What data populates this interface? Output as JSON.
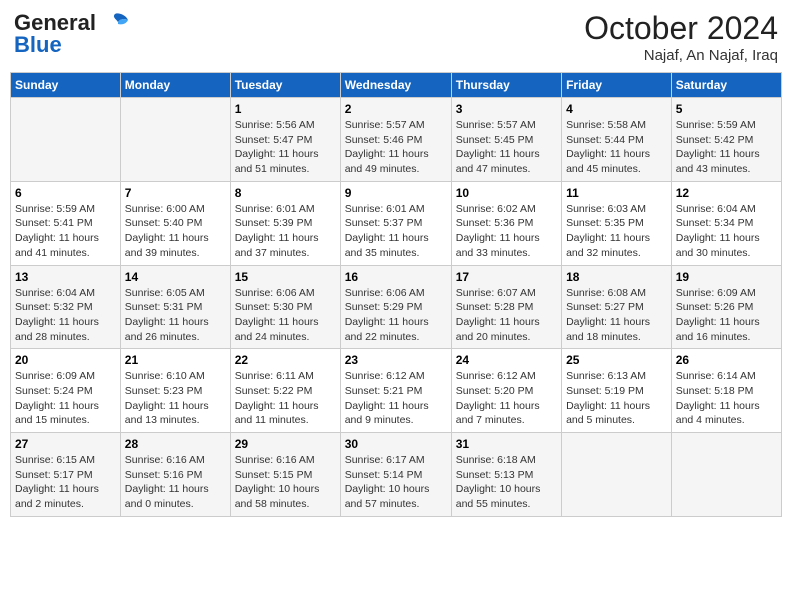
{
  "header": {
    "logo_general": "General",
    "logo_blue": "Blue",
    "month_title": "October 2024",
    "location": "Najaf, An Najaf, Iraq"
  },
  "weekdays": [
    "Sunday",
    "Monday",
    "Tuesday",
    "Wednesday",
    "Thursday",
    "Friday",
    "Saturday"
  ],
  "weeks": [
    [
      {
        "day": "",
        "sunrise": "",
        "sunset": "",
        "daylight": ""
      },
      {
        "day": "",
        "sunrise": "",
        "sunset": "",
        "daylight": ""
      },
      {
        "day": "1",
        "sunrise": "Sunrise: 5:56 AM",
        "sunset": "Sunset: 5:47 PM",
        "daylight": "Daylight: 11 hours and 51 minutes."
      },
      {
        "day": "2",
        "sunrise": "Sunrise: 5:57 AM",
        "sunset": "Sunset: 5:46 PM",
        "daylight": "Daylight: 11 hours and 49 minutes."
      },
      {
        "day": "3",
        "sunrise": "Sunrise: 5:57 AM",
        "sunset": "Sunset: 5:45 PM",
        "daylight": "Daylight: 11 hours and 47 minutes."
      },
      {
        "day": "4",
        "sunrise": "Sunrise: 5:58 AM",
        "sunset": "Sunset: 5:44 PM",
        "daylight": "Daylight: 11 hours and 45 minutes."
      },
      {
        "day": "5",
        "sunrise": "Sunrise: 5:59 AM",
        "sunset": "Sunset: 5:42 PM",
        "daylight": "Daylight: 11 hours and 43 minutes."
      }
    ],
    [
      {
        "day": "6",
        "sunrise": "Sunrise: 5:59 AM",
        "sunset": "Sunset: 5:41 PM",
        "daylight": "Daylight: 11 hours and 41 minutes."
      },
      {
        "day": "7",
        "sunrise": "Sunrise: 6:00 AM",
        "sunset": "Sunset: 5:40 PM",
        "daylight": "Daylight: 11 hours and 39 minutes."
      },
      {
        "day": "8",
        "sunrise": "Sunrise: 6:01 AM",
        "sunset": "Sunset: 5:39 PM",
        "daylight": "Daylight: 11 hours and 37 minutes."
      },
      {
        "day": "9",
        "sunrise": "Sunrise: 6:01 AM",
        "sunset": "Sunset: 5:37 PM",
        "daylight": "Daylight: 11 hours and 35 minutes."
      },
      {
        "day": "10",
        "sunrise": "Sunrise: 6:02 AM",
        "sunset": "Sunset: 5:36 PM",
        "daylight": "Daylight: 11 hours and 33 minutes."
      },
      {
        "day": "11",
        "sunrise": "Sunrise: 6:03 AM",
        "sunset": "Sunset: 5:35 PM",
        "daylight": "Daylight: 11 hours and 32 minutes."
      },
      {
        "day": "12",
        "sunrise": "Sunrise: 6:04 AM",
        "sunset": "Sunset: 5:34 PM",
        "daylight": "Daylight: 11 hours and 30 minutes."
      }
    ],
    [
      {
        "day": "13",
        "sunrise": "Sunrise: 6:04 AM",
        "sunset": "Sunset: 5:32 PM",
        "daylight": "Daylight: 11 hours and 28 minutes."
      },
      {
        "day": "14",
        "sunrise": "Sunrise: 6:05 AM",
        "sunset": "Sunset: 5:31 PM",
        "daylight": "Daylight: 11 hours and 26 minutes."
      },
      {
        "day": "15",
        "sunrise": "Sunrise: 6:06 AM",
        "sunset": "Sunset: 5:30 PM",
        "daylight": "Daylight: 11 hours and 24 minutes."
      },
      {
        "day": "16",
        "sunrise": "Sunrise: 6:06 AM",
        "sunset": "Sunset: 5:29 PM",
        "daylight": "Daylight: 11 hours and 22 minutes."
      },
      {
        "day": "17",
        "sunrise": "Sunrise: 6:07 AM",
        "sunset": "Sunset: 5:28 PM",
        "daylight": "Daylight: 11 hours and 20 minutes."
      },
      {
        "day": "18",
        "sunrise": "Sunrise: 6:08 AM",
        "sunset": "Sunset: 5:27 PM",
        "daylight": "Daylight: 11 hours and 18 minutes."
      },
      {
        "day": "19",
        "sunrise": "Sunrise: 6:09 AM",
        "sunset": "Sunset: 5:26 PM",
        "daylight": "Daylight: 11 hours and 16 minutes."
      }
    ],
    [
      {
        "day": "20",
        "sunrise": "Sunrise: 6:09 AM",
        "sunset": "Sunset: 5:24 PM",
        "daylight": "Daylight: 11 hours and 15 minutes."
      },
      {
        "day": "21",
        "sunrise": "Sunrise: 6:10 AM",
        "sunset": "Sunset: 5:23 PM",
        "daylight": "Daylight: 11 hours and 13 minutes."
      },
      {
        "day": "22",
        "sunrise": "Sunrise: 6:11 AM",
        "sunset": "Sunset: 5:22 PM",
        "daylight": "Daylight: 11 hours and 11 minutes."
      },
      {
        "day": "23",
        "sunrise": "Sunrise: 6:12 AM",
        "sunset": "Sunset: 5:21 PM",
        "daylight": "Daylight: 11 hours and 9 minutes."
      },
      {
        "day": "24",
        "sunrise": "Sunrise: 6:12 AM",
        "sunset": "Sunset: 5:20 PM",
        "daylight": "Daylight: 11 hours and 7 minutes."
      },
      {
        "day": "25",
        "sunrise": "Sunrise: 6:13 AM",
        "sunset": "Sunset: 5:19 PM",
        "daylight": "Daylight: 11 hours and 5 minutes."
      },
      {
        "day": "26",
        "sunrise": "Sunrise: 6:14 AM",
        "sunset": "Sunset: 5:18 PM",
        "daylight": "Daylight: 11 hours and 4 minutes."
      }
    ],
    [
      {
        "day": "27",
        "sunrise": "Sunrise: 6:15 AM",
        "sunset": "Sunset: 5:17 PM",
        "daylight": "Daylight: 11 hours and 2 minutes."
      },
      {
        "day": "28",
        "sunrise": "Sunrise: 6:16 AM",
        "sunset": "Sunset: 5:16 PM",
        "daylight": "Daylight: 11 hours and 0 minutes."
      },
      {
        "day": "29",
        "sunrise": "Sunrise: 6:16 AM",
        "sunset": "Sunset: 5:15 PM",
        "daylight": "Daylight: 10 hours and 58 minutes."
      },
      {
        "day": "30",
        "sunrise": "Sunrise: 6:17 AM",
        "sunset": "Sunset: 5:14 PM",
        "daylight": "Daylight: 10 hours and 57 minutes."
      },
      {
        "day": "31",
        "sunrise": "Sunrise: 6:18 AM",
        "sunset": "Sunset: 5:13 PM",
        "daylight": "Daylight: 10 hours and 55 minutes."
      },
      {
        "day": "",
        "sunrise": "",
        "sunset": "",
        "daylight": ""
      },
      {
        "day": "",
        "sunrise": "",
        "sunset": "",
        "daylight": ""
      }
    ]
  ]
}
